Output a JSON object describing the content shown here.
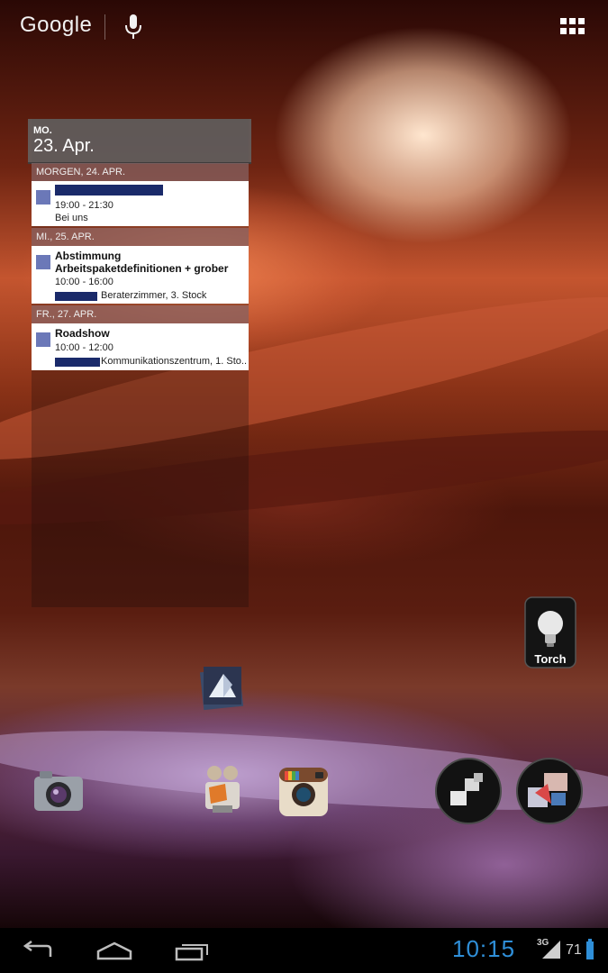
{
  "search": {
    "brand": "Google"
  },
  "calendar": {
    "weekday": "MO.",
    "date": "23. Apr.",
    "sections": [
      {
        "header": "MORGEN, 24. APR.",
        "events": [
          {
            "title": "",
            "time": "19:00 - 21:30",
            "location": "Bei uns"
          }
        ]
      },
      {
        "header": "MI., 25. APR.",
        "events": [
          {
            "title": "Abstimmung Arbeitspaketdefinitionen + grober",
            "time": "10:00 - 16:00",
            "location": "Berater­zimmer, 3. Stock"
          }
        ]
      },
      {
        "header": "FR., 27. APR.",
        "events": [
          {
            "title": "Roadshow",
            "time": "10:00 - 12:00",
            "location": "Kommunikationszentrum, 1. Sto..."
          }
        ]
      }
    ],
    "event_color": "#6b78b8"
  },
  "apps": {
    "torch": "Torch"
  },
  "status": {
    "time": "10:15",
    "network": "3G",
    "battery": "71"
  },
  "accent": "#2f8fd8"
}
